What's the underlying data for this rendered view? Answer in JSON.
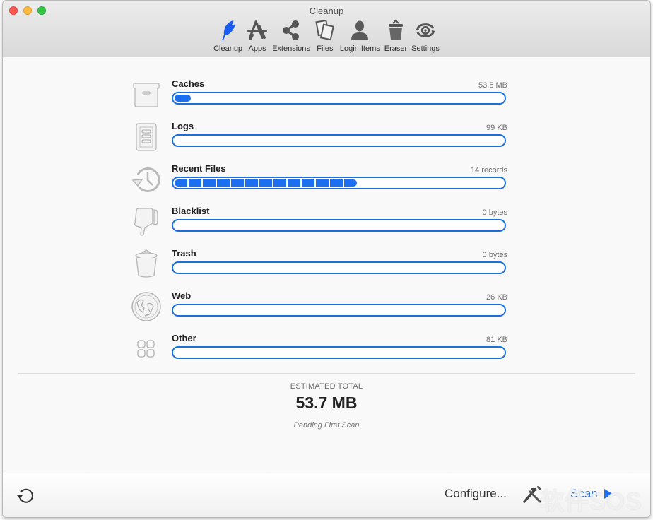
{
  "window": {
    "title": "Cleanup"
  },
  "toolbar": {
    "items": [
      {
        "label": "Cleanup",
        "icon": "feather-icon",
        "active": true
      },
      {
        "label": "Apps",
        "icon": "app-store-icon",
        "active": false
      },
      {
        "label": "Extensions",
        "icon": "share-icon",
        "active": false
      },
      {
        "label": "Files",
        "icon": "files-icon",
        "active": false
      },
      {
        "label": "Login Items",
        "icon": "user-silhouette-icon",
        "active": false
      },
      {
        "label": "Eraser",
        "icon": "trash-can-icon",
        "active": false
      },
      {
        "label": "Settings",
        "icon": "settings-eye-icon",
        "active": false
      }
    ]
  },
  "categories": [
    {
      "name": "Caches",
      "size": "53.5 MB",
      "icon": "archive-box-icon",
      "fill_fraction": 0.05
    },
    {
      "name": "Logs",
      "size": "99 KB",
      "icon": "log-document-icon",
      "fill_fraction": 0
    },
    {
      "name": "Recent Files",
      "size": "14 records",
      "icon": "history-clock-icon",
      "segments": 13
    },
    {
      "name": "Blacklist",
      "size": "0 bytes",
      "icon": "thumbs-down-icon",
      "fill_fraction": 0
    },
    {
      "name": "Trash",
      "size": "0 bytes",
      "icon": "trash-icon",
      "fill_fraction": 0
    },
    {
      "name": "Web",
      "size": "26 KB",
      "icon": "globe-icon",
      "fill_fraction": 0
    },
    {
      "name": "Other",
      "size": "81 KB",
      "icon": "grid-icon",
      "fill_fraction": 0
    }
  ],
  "summary": {
    "label": "ESTIMATED TOTAL",
    "value": "53.7 MB",
    "status": "Pending First Scan"
  },
  "footer": {
    "configure_label": "Configure...",
    "scan_label": "Scan",
    "watermark": "软件SOS"
  },
  "colors": {
    "accent": "#1b6ff0",
    "track_border": "#1a6fdc",
    "scan_text": "#2c74d8"
  }
}
